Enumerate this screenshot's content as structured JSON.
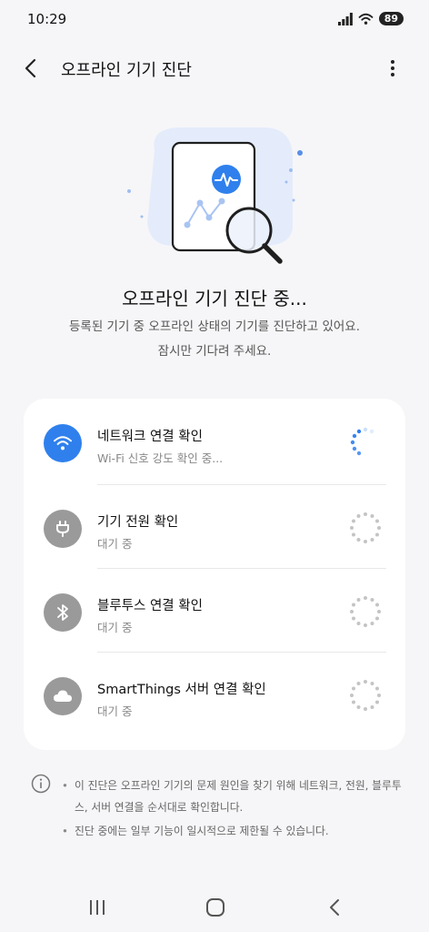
{
  "status": {
    "time": "10:29",
    "battery": "89"
  },
  "header": {
    "title": "오프라인 기기 진단"
  },
  "main": {
    "title": "오프라인 기기 진단 중...",
    "desc_line1": "등록된 기기 중 오프라인 상태의 기기를 진단하고 있어요.",
    "desc_line2": "잠시만 기다려 주세요."
  },
  "checks": [
    {
      "title": "네트워크 연결 확인",
      "status": "Wi-Fi 신호 강도 확인 중...",
      "icon": "wifi-icon",
      "active": true
    },
    {
      "title": "기기 전원 확인",
      "status": "대기 중",
      "icon": "plug-icon",
      "active": false
    },
    {
      "title": "블루투스 연결 확인",
      "status": "대기 중",
      "icon": "bluetooth-icon",
      "active": false
    },
    {
      "title": "SmartThings 서버 연결 확인",
      "status": "대기 중",
      "icon": "cloud-icon",
      "active": false
    }
  ],
  "info": [
    "이 진단은 오프라인 기기의 문제 원인을 찾기 위해 네트워크, 전원, 블루투스, 서버 연결을 순서대로 확인합니다.",
    "진단 중에는 일부 기능이 일시적으로 제한될 수 있습니다."
  ],
  "colors": {
    "accent": "#2f80ed",
    "inactive": "#9a9a9a",
    "background": "#f6f6f8",
    "card": "#ffffff"
  }
}
